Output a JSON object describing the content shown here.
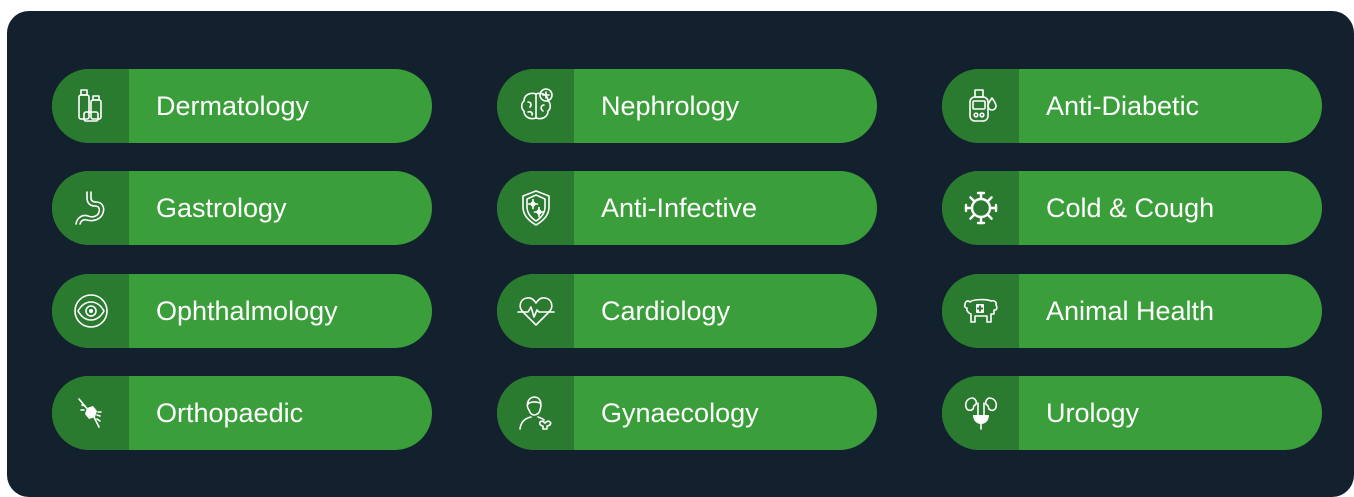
{
  "categories": [
    {
      "label": "Dermatology",
      "icon": "cosmetic-bottles-icon"
    },
    {
      "label": "Nephrology",
      "icon": "brain-plus-icon"
    },
    {
      "label": "Anti-Diabetic",
      "icon": "glucometer-drop-icon"
    },
    {
      "label": "Gastrology",
      "icon": "stomach-icon"
    },
    {
      "label": "Anti-Infective",
      "icon": "shield-virus-icon"
    },
    {
      "label": "Cold & Cough",
      "icon": "virus-icon"
    },
    {
      "label": "Ophthalmology",
      "icon": "eye-icon"
    },
    {
      "label": "Cardiology",
      "icon": "heart-pulse-icon"
    },
    {
      "label": "Animal Health",
      "icon": "cow-cross-icon"
    },
    {
      "label": "Orthopaedic",
      "icon": "knee-joint-icon"
    },
    {
      "label": "Gynaecology",
      "icon": "woman-uterus-icon"
    },
    {
      "label": "Urology",
      "icon": "kidneys-bladder-icon"
    }
  ],
  "colors": {
    "background": "#13212f",
    "pill": "#3a9e3a",
    "pill_cap": "#2a7a2f",
    "text": "#ffffff"
  }
}
